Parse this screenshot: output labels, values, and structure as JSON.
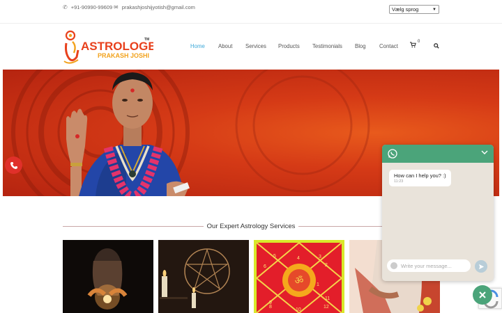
{
  "topbar": {
    "phone": "+91-90990-99609",
    "email": "prakashjoshijyotish@gmail.com",
    "language_select": "Vælg sprog"
  },
  "logo": {
    "line1": "ASTROLOGER",
    "line2": "PRAKASH JOSHI",
    "tm": "TM"
  },
  "nav": {
    "items": [
      "Home",
      "About",
      "Services",
      "Products",
      "Testimonials",
      "Blog",
      "Contact"
    ],
    "active": "Home",
    "cart_count": "0"
  },
  "services": {
    "title": "Our Expert Astrology Services",
    "chart_numbers": [
      "5",
      "4",
      "3",
      "2",
      "6",
      "9",
      "12",
      "1",
      "8",
      "10",
      "11"
    ]
  },
  "whatsapp": {
    "message": "How can I help you? :)",
    "time": "11:23",
    "placeholder": "Write your message..."
  },
  "colors": {
    "accent": "#3aa7d8",
    "whatsapp_green": "#4ba47a",
    "hero_red": "#d53a16",
    "phone_red": "#e0302a"
  }
}
